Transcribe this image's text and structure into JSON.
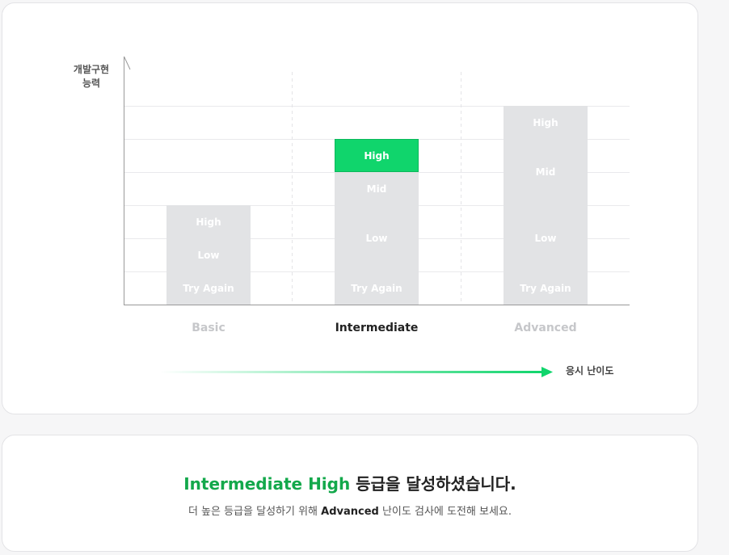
{
  "chart": {
    "y_label": "개발구현\n능력",
    "x_label": "응시 난이도",
    "levels": [
      {
        "name": "Basic",
        "active": false,
        "segments": [
          {
            "label": "Try Again",
            "units": 1
          },
          {
            "label": "Low",
            "units": 1
          },
          {
            "label": "High",
            "units": 1
          }
        ]
      },
      {
        "name": "Intermediate",
        "active": true,
        "segments": [
          {
            "label": "Try Again",
            "units": 1
          },
          {
            "label": "Low",
            "units": 2
          },
          {
            "label": "Mid",
            "units": 1
          },
          {
            "label": "High",
            "units": 1,
            "active": true
          }
        ]
      },
      {
        "name": "Advanced",
        "active": false,
        "segments": [
          {
            "label": "Try Again",
            "units": 1
          },
          {
            "label": "Low",
            "units": 2
          },
          {
            "label": "Mid",
            "units": 2
          },
          {
            "label": "High",
            "units": 1
          }
        ]
      }
    ],
    "colors": {
      "segment": "#e2e3e5",
      "active": "#10d56c",
      "accent_text": "#13a84b"
    }
  },
  "result": {
    "title_grade": "Intermediate High",
    "title_suffix": " 등급을 달성하셨습니다.",
    "desc_prefix": "더 높은 등급을 달성하기 위해 ",
    "desc_level": "Advanced",
    "desc_suffix": " 난이도 검사에 도전해 보세요."
  }
}
